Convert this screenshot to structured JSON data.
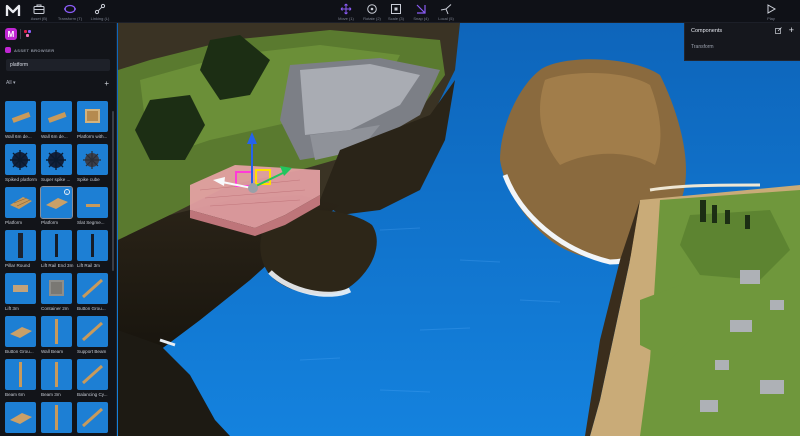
{
  "toolbar": {
    "left": [
      {
        "label": "Asset (B)",
        "icon": "briefcase-icon"
      },
      {
        "label": "Transform (T)",
        "icon": "transform-gizmo-icon"
      },
      {
        "label": "Linking (L)",
        "icon": "link-nodes-icon"
      }
    ],
    "center": [
      {
        "label": "Move (1)",
        "icon": "move-icon"
      },
      {
        "label": "Rotate (2)",
        "icon": "rotate-icon"
      },
      {
        "label": "Scale (3)",
        "icon": "scale-icon"
      },
      {
        "label": "Snap (4)",
        "icon": "snap-icon"
      },
      {
        "label": "Local (5)",
        "icon": "local-axes-icon"
      }
    ],
    "right": {
      "label": "Play",
      "icon": "play-icon"
    },
    "accent_color": "#8b5cf6"
  },
  "sidebar": {
    "section_title": "ASSET BROWSER",
    "search_value": "platform",
    "filter_label": "All",
    "filter_add": "+",
    "assets": [
      {
        "name": "Wall 6m de...",
        "thumb": "plank"
      },
      {
        "name": "Wall 6m de...",
        "thumb": "plank"
      },
      {
        "name": "Platform with...",
        "thumb": "wood-square"
      },
      {
        "name": "Spiked platform",
        "thumb": "spiked"
      },
      {
        "name": "Super spike ...",
        "thumb": "spiked"
      },
      {
        "name": "Spike cube",
        "thumb": "spike-ball"
      },
      {
        "name": "Platform",
        "thumb": "plank-grid"
      },
      {
        "name": "Platform",
        "thumb": "plank-flat",
        "selected": true
      },
      {
        "name": "Slat Segme...",
        "thumb": "slat"
      },
      {
        "name": "Pillar Round",
        "thumb": "pillar"
      },
      {
        "name": "Lift Rail End 3m",
        "thumb": "rail"
      },
      {
        "name": "Lift Rail 3m",
        "thumb": "rail"
      },
      {
        "name": "Lift 3m",
        "thumb": "lift"
      },
      {
        "name": "Container 2m",
        "thumb": "container"
      },
      {
        "name": "Button Grou...",
        "thumb": "diagonal"
      },
      {
        "name": "Button Grou...",
        "thumb": "plank-flat"
      },
      {
        "name": "Wall Beam",
        "thumb": "beam"
      },
      {
        "name": "Support Beam",
        "thumb": "diagonal"
      },
      {
        "name": "Beam 6m",
        "thumb": "beam"
      },
      {
        "name": "Beam 3m",
        "thumb": "beam"
      },
      {
        "name": "Balancing Cy...",
        "thumb": "diagonal"
      },
      {
        "name": "",
        "thumb": "plank-flat"
      },
      {
        "name": "",
        "thumb": "beam"
      },
      {
        "name": "",
        "thumb": "diagonal"
      }
    ]
  },
  "components": {
    "title": "Components",
    "items": [
      "Transform"
    ]
  }
}
